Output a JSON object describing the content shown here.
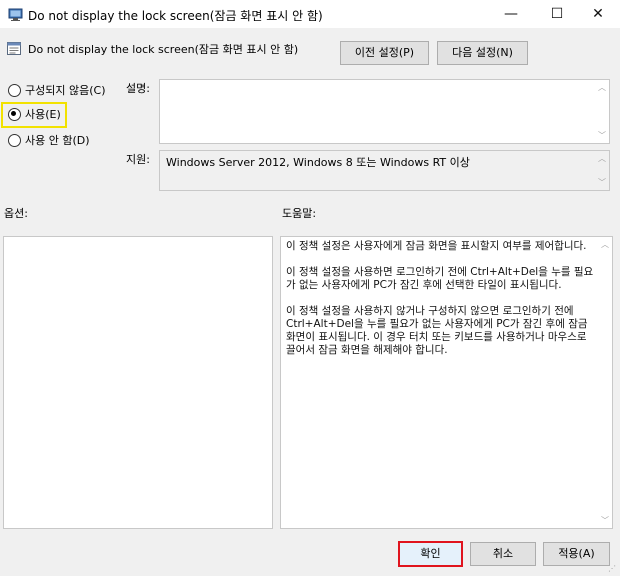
{
  "window": {
    "title": "Do not display the lock screen(잠금 화면 표시 안 함)",
    "minimize_glyph": "—",
    "maximize_glyph": "☐",
    "close_glyph": "✕"
  },
  "header": {
    "policy_title": "Do not display the lock screen(잠금 화면 표시 안 함)",
    "prev_label": "이전 설정(P)",
    "next_label": "다음 설정(N)"
  },
  "options": {
    "radios": [
      {
        "label": "구성되지 않음(C)",
        "selected": false
      },
      {
        "label": "사용(E)",
        "selected": true
      },
      {
        "label": "사용 안 함(D)",
        "selected": false
      }
    ],
    "highlight_color": "#f2e200"
  },
  "comment": {
    "label": "설명:",
    "value": ""
  },
  "supported": {
    "label": "지원:",
    "value": "Windows Server 2012, Windows 8 또는 Windows RT 이상"
  },
  "panes": {
    "options_label": "옵션:",
    "help_label": "도움말:",
    "help_paragraphs": [
      "이 정책 설정은 사용자에게 잠금 화면을 표시할지 여부를 제어합니다.",
      "이 정책 설정을 사용하면 로그인하기 전에 Ctrl+Alt+Del을 누를 필요가 없는 사용자에게 PC가 잠긴 후에 선택한 타일이 표시됩니다.",
      "이 정책 설정을 사용하지 않거나 구성하지 않으면 로그인하기 전에 Ctrl+Alt+Del을 누를 필요가 없는 사용자에게 PC가 잠긴 후에 잠금 화면이 표시됩니다. 이 경우 터치 또는 키보드를 사용하거나 마우스로 끌어서 잠금 화면을 해제해야 합니다."
    ]
  },
  "footer": {
    "ok_label": "확인",
    "cancel_label": "취소",
    "apply_label": "적용(A)",
    "ok_highlight_color": "#e0141e"
  }
}
